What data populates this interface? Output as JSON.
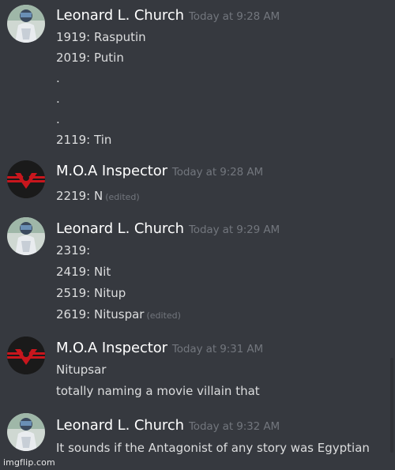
{
  "messages": [
    {
      "author": "Leonard L. Church",
      "timestamp": "Today at 9:28 AM",
      "lines": [
        {
          "text": "1919: Rasputin"
        },
        {
          "text": "2019: Putin"
        },
        {
          "text": "."
        },
        {
          "text": "."
        },
        {
          "text": "."
        },
        {
          "text": "2119: Tin"
        }
      ]
    },
    {
      "author": "M.O.A Inspector",
      "timestamp": "Today at 9:28 AM",
      "lines": [
        {
          "text": "2219: N",
          "edited": "(edited)"
        }
      ]
    },
    {
      "author": "Leonard L. Church",
      "timestamp": "Today at 9:29 AM",
      "lines": [
        {
          "text": "2319:"
        },
        {
          "text": "2419: Nit"
        },
        {
          "text": "2519: Nitup"
        },
        {
          "text": "2619: Nituspar",
          "edited": "(edited)"
        }
      ]
    },
    {
      "author": "M.O.A Inspector",
      "timestamp": "Today at 9:31 AM",
      "lines": [
        {
          "text": "Nitupsar"
        },
        {
          "text": "totally naming a movie villain that"
        }
      ]
    },
    {
      "author": "Leonard L. Church",
      "timestamp": "Today at 9:32 AM",
      "lines": [
        {
          "text": "It sounds if the Antagonist of any story was Egyptian"
        }
      ]
    }
  ],
  "watermark": "imgflip.com",
  "colors": {
    "background": "#36393f",
    "username": "#ffffff",
    "timestamp": "#72767d",
    "message_text": "#dcddde",
    "inspector_badge_red": "#c8161d"
  }
}
